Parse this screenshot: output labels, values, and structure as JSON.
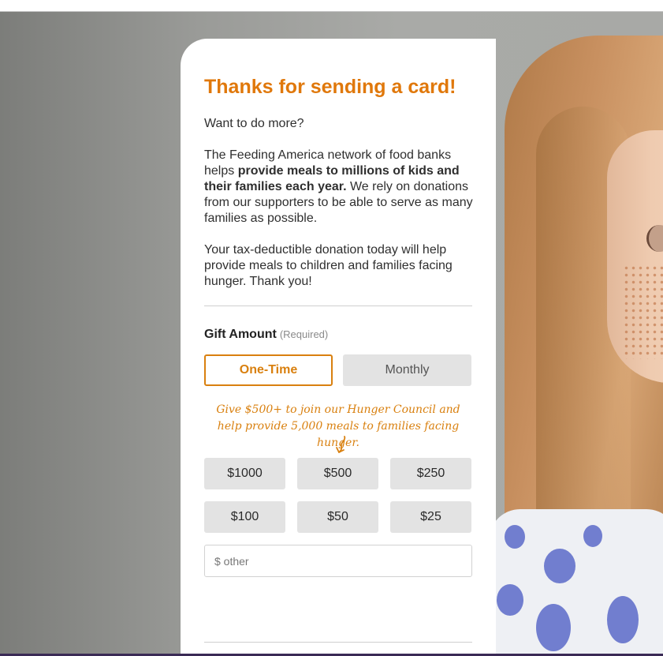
{
  "card": {
    "heading": "Thanks for sending a card!",
    "want_more": "Want to do more?",
    "network_para": {
      "part1": "The Feeding America network of food banks helps ",
      "bold": "provide meals to millions of kids and their families each year.",
      "part2": " We rely on donations from our supporters to be able to serve as many families as possible."
    },
    "tax_para": "Your tax-deductible donation today will help provide meals to children and families facing hunger. Thank you!"
  },
  "gift": {
    "label": "Gift Amount",
    "required": "(Required)",
    "frequency": {
      "options": [
        "One-Time",
        "Monthly"
      ],
      "selected": "One-Time"
    },
    "promo": "Give $500+ to join our Hunger Council and help provide 5,000 meals to families facing hunger.",
    "amounts": [
      "$1000",
      "$500",
      "$250",
      "$100",
      "$50",
      "$25"
    ],
    "other_placeholder": "$ other"
  },
  "colors": {
    "accent": "#e0780b",
    "button_bg": "#e3e3e3",
    "text": "#2f2f2f"
  },
  "icons": {
    "promo_arrow": "hand-drawn-arrow-icon"
  }
}
